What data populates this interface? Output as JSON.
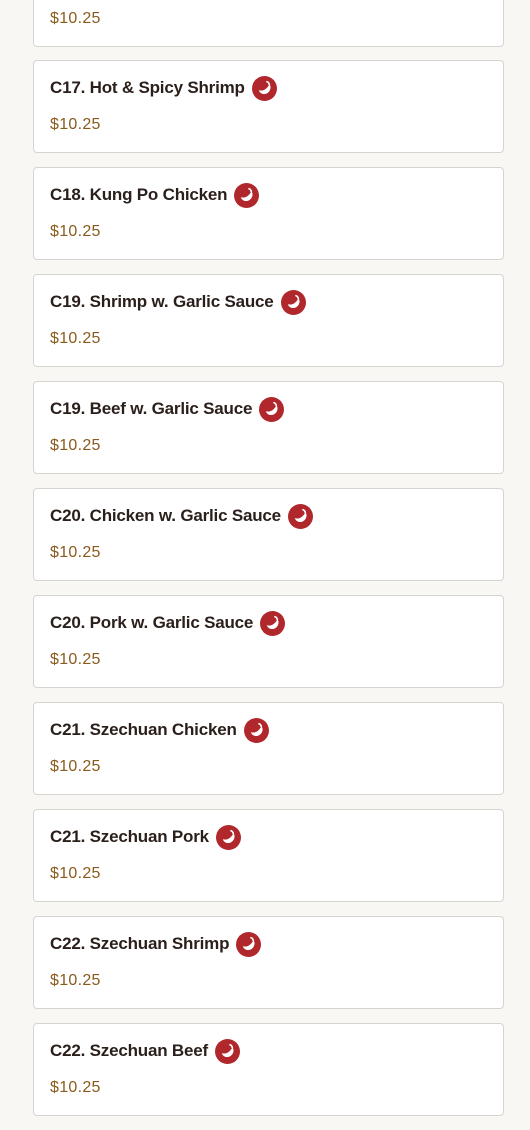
{
  "menu": {
    "items": [
      {
        "name": "",
        "price": "$10.25",
        "spicy": false
      },
      {
        "name": "C17. Hot & Spicy Shrimp",
        "price": "$10.25",
        "spicy": true
      },
      {
        "name": "C18. Kung Po Chicken",
        "price": "$10.25",
        "spicy": true
      },
      {
        "name": "C19. Shrimp w. Garlic Sauce",
        "price": "$10.25",
        "spicy": true
      },
      {
        "name": "C19. Beef w. Garlic Sauce",
        "price": "$10.25",
        "spicy": true
      },
      {
        "name": "C20. Chicken w. Garlic Sauce",
        "price": "$10.25",
        "spicy": true
      },
      {
        "name": "C20. Pork w. Garlic Sauce",
        "price": "$10.25",
        "spicy": true
      },
      {
        "name": "C21. Szechuan Chicken",
        "price": "$10.25",
        "spicy": true
      },
      {
        "name": "C21. Szechuan Pork",
        "price": "$10.25",
        "spicy": true
      },
      {
        "name": "C22. Szechuan Shrimp",
        "price": "$10.25",
        "spicy": true
      },
      {
        "name": "C22. Szechuan Beef",
        "price": "$10.25",
        "spicy": true
      }
    ]
  },
  "icons": {
    "spicy": "chili-pepper-icon"
  },
  "colors": {
    "spicy_badge": "#b0282c",
    "price": "#8a5a1c",
    "name": "#2a1f1a"
  }
}
